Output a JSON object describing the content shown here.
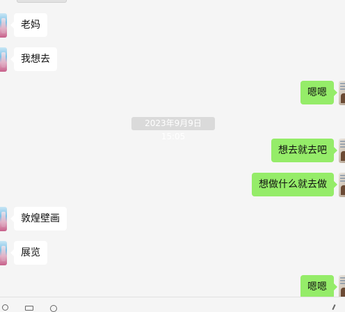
{
  "conversation": {
    "messages": [
      {
        "side": "left",
        "text": "老妈"
      },
      {
        "side": "left",
        "text": "我想去"
      },
      {
        "side": "right",
        "text": "嗯嗯"
      },
      {
        "side": "right",
        "text": "想去就去吧"
      },
      {
        "side": "right",
        "text": "想做什么就去做"
      },
      {
        "side": "left",
        "text": "敦煌壁画"
      },
      {
        "side": "left",
        "text": "展览"
      },
      {
        "side": "right",
        "text": "嗯嗯"
      }
    ],
    "timestamp": "2023年9月9日 15:05"
  },
  "colors": {
    "chat_background": "#f5f5f5",
    "incoming_bubble": "#ffffff",
    "outgoing_bubble": "#95ec69",
    "timestamp_background": "#dadada"
  },
  "toolbar": {
    "icons": [
      "emoji-icon",
      "folder-icon",
      "scissors-icon",
      "more-icon"
    ]
  }
}
